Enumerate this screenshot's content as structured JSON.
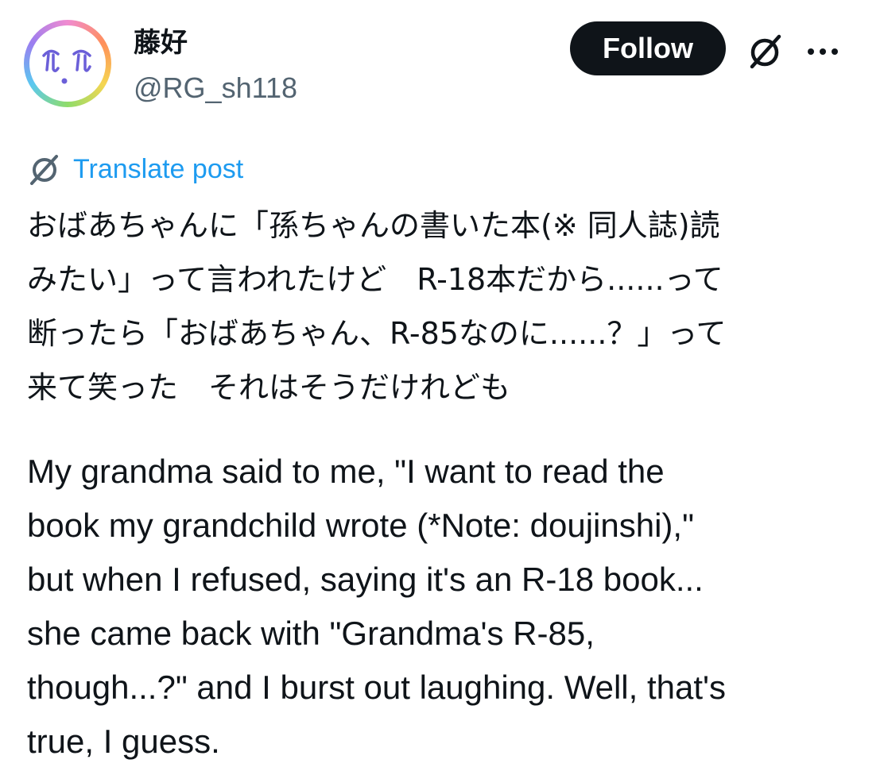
{
  "author": {
    "display_name": "藤好",
    "handle": "@RG_sh118",
    "avatar_icon": "face-avatar-icon"
  },
  "actions": {
    "follow_label": "Follow",
    "grok_icon": "grok-icon",
    "more_icon": "more-options-icon"
  },
  "translate": {
    "label": "Translate post",
    "icon": "grok-icon"
  },
  "post": {
    "japanese_lines": [
      "おばあちゃんに「孫ちゃんの書いた本(※ 同人誌)読",
      "みたい」って言われたけど　R-18本だから......って",
      "断ったら「おばあちゃん、R-85なのに......？」って",
      "来て笑った　それはそうだけれども"
    ],
    "english_lines": [
      "My grandma said to me, \"I want to read the",
      "book my grandchild wrote (*Note: doujinshi),\"",
      "but when I refused, saying it's an R-18 book...",
      "she came back with \"Grandma's R-85,",
      "though...?\" and I burst out laughing. Well, that's",
      "true, I guess."
    ]
  },
  "colors": {
    "text": "#0f1419",
    "secondary": "#536471",
    "link": "#1d9bf0",
    "button_bg": "#0f1419"
  }
}
